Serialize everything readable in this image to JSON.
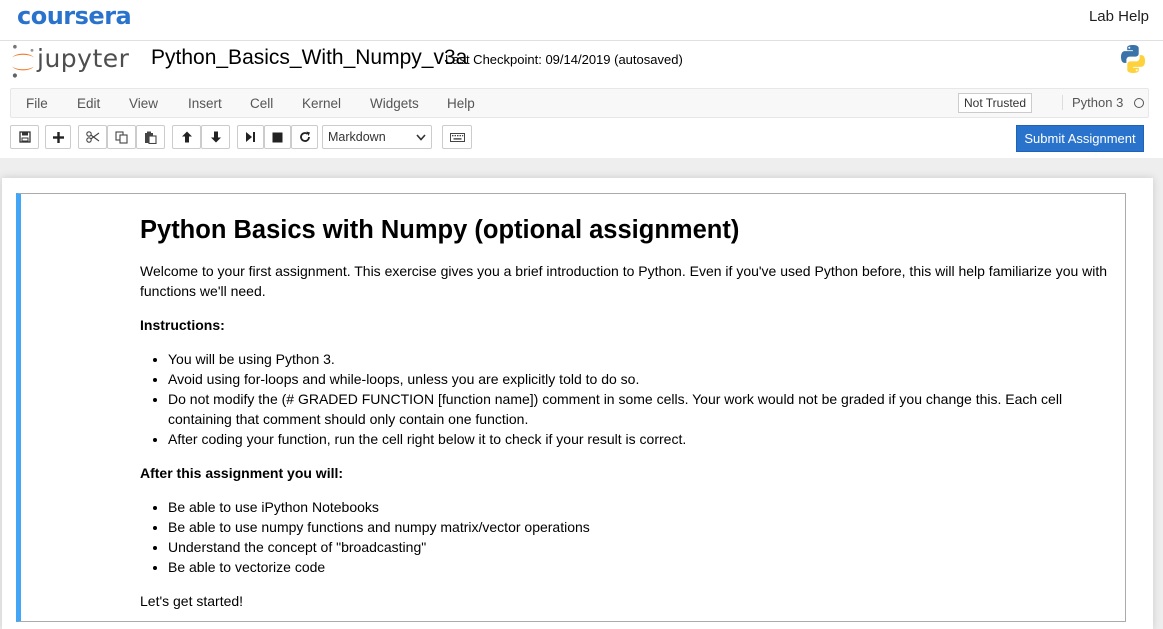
{
  "coursera": {
    "logo": "coursera",
    "lab_help": "Lab Help"
  },
  "jupyter": {
    "logo_text": "jupyter",
    "notebook_name": "Python_Basics_With_Numpy_v3a",
    "checkpoint": "Last Checkpoint: 09/14/2019 (autosaved)"
  },
  "menu": {
    "items": [
      "File",
      "Edit",
      "View",
      "Insert",
      "Cell",
      "Kernel",
      "Widgets",
      "Help"
    ],
    "trust": "Not Trusted",
    "kernel": "Python 3"
  },
  "toolbar": {
    "cell_type": "Markdown",
    "submit": "Submit Assignment",
    "buttons": [
      "save-icon",
      "plus-icon",
      "cut-icon",
      "copy-icon",
      "paste-icon",
      "arrow-up-icon",
      "arrow-down-icon",
      "run-icon",
      "stop-icon",
      "restart-icon",
      "keyboard-icon"
    ]
  },
  "cell": {
    "title": "Python Basics with Numpy (optional assignment)",
    "intro": "Welcome to your first assignment. This exercise gives you a brief introduction to Python. Even if you've used Python before, this will help familiarize you with functions we'll need.",
    "instructions_heading": "Instructions:",
    "instructions": [
      "You will be using Python 3.",
      "Avoid using for-loops and while-loops, unless you are explicitly told to do so.",
      "Do not modify the (# GRADED FUNCTION [function name]) comment in some cells. Your work would not be graded if you change this. Each cell containing that comment should only contain one function.",
      "After coding your function, run the cell right below it to check if your result is correct."
    ],
    "after_heading": "After this assignment you will:",
    "after_items": [
      "Be able to use iPython Notebooks",
      "Be able to use numpy functions and numpy matrix/vector operations",
      "Understand the concept of \"broadcasting\"",
      "Be able to vectorize code"
    ],
    "closing": "Let's get started!"
  },
  "colors": {
    "coursera_blue": "#2a73cc",
    "cell_border": "#42a5f5"
  }
}
